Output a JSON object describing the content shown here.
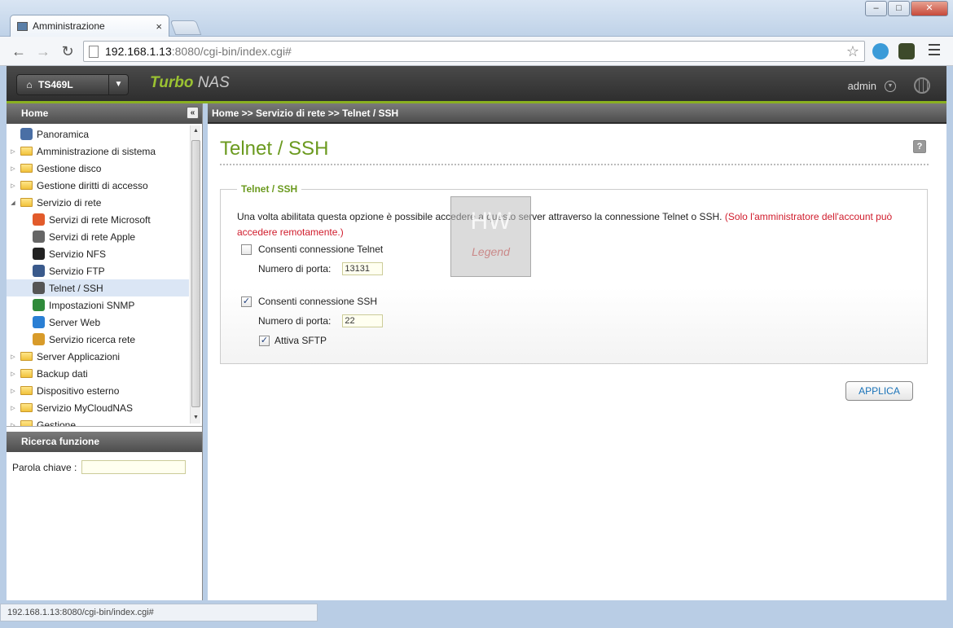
{
  "browser": {
    "tab_title": "Amministrazione",
    "tab_close": "×",
    "url_host": "192.168.1.13",
    "url_rest": ":8080/cgi-bin/index.cgi#",
    "status_url": "192.168.1.13:8080/cgi-bin/index.cgi#",
    "window_buttons": {
      "minimize": "–",
      "maximize": "□",
      "close": "✕"
    }
  },
  "header": {
    "device": "TS469L",
    "brand_1": "Turbo",
    "brand_2": "NAS",
    "user": "admin"
  },
  "sidebar": {
    "title": "Home",
    "items": [
      {
        "label": "Panoramica",
        "type": "leaf",
        "level": 0,
        "icon": "overview-icon"
      },
      {
        "label": "Amministrazione di sistema",
        "type": "folder",
        "level": 0
      },
      {
        "label": "Gestione disco",
        "type": "folder",
        "level": 0
      },
      {
        "label": "Gestione diritti di accesso",
        "type": "folder",
        "level": 0
      },
      {
        "label": "Servizio di rete",
        "type": "folder-open",
        "level": 0
      },
      {
        "label": "Servizi di rete Microsoft",
        "type": "leaf",
        "level": 1,
        "icon": "windows-icon"
      },
      {
        "label": "Servizi di rete Apple",
        "type": "leaf",
        "level": 1,
        "icon": "apple-icon"
      },
      {
        "label": "Servizio NFS",
        "type": "leaf",
        "level": 1,
        "icon": "linux-icon"
      },
      {
        "label": "Servizio FTP",
        "type": "leaf",
        "level": 1,
        "icon": "ftp-icon"
      },
      {
        "label": "Telnet / SSH",
        "type": "leaf",
        "level": 1,
        "icon": "terminal-icon",
        "selected": true
      },
      {
        "label": "Impostazioni SNMP",
        "type": "leaf",
        "level": 1,
        "icon": "snmp-icon"
      },
      {
        "label": "Server Web",
        "type": "leaf",
        "level": 1,
        "icon": "web-icon"
      },
      {
        "label": "Servizio ricerca rete",
        "type": "leaf",
        "level": 1,
        "icon": "discovery-icon"
      },
      {
        "label": "Server Applicazioni",
        "type": "folder",
        "level": 0
      },
      {
        "label": "Backup dati",
        "type": "folder",
        "level": 0
      },
      {
        "label": "Dispositivo esterno",
        "type": "folder",
        "level": 0
      },
      {
        "label": "Servizio MyCloudNAS",
        "type": "folder",
        "level": 0
      },
      {
        "label": "Gestione",
        "type": "folder",
        "level": 0
      }
    ],
    "search_title": "Ricerca funzione",
    "keyword_label": "Parola chiave :",
    "keyword_value": ""
  },
  "main": {
    "breadcrumb": "Home >> Servizio di rete >> Telnet / SSH",
    "title": "Telnet / SSH",
    "help": "?",
    "section_title": "Telnet / SSH",
    "description": "Una volta abilitata questa opzione è possibile accedere a questo server attraverso la connessione Telnet o SSH.",
    "description_note": "(Solo l'amministratore dell'account può accedere remotamente.)",
    "telnet_label": "Consenti connessione Telnet",
    "telnet_checked": false,
    "telnet_port_label": "Numero di porta:",
    "telnet_port": "13131",
    "ssh_label": "Consenti connessione SSH",
    "ssh_checked": true,
    "ssh_port_label": "Numero di porta:",
    "ssh_port": "22",
    "sftp_label": "Attiva SFTP",
    "sftp_checked": true,
    "apply": "APPLICA"
  },
  "watermark": {
    "text": "HW",
    "text2": "Legend"
  }
}
